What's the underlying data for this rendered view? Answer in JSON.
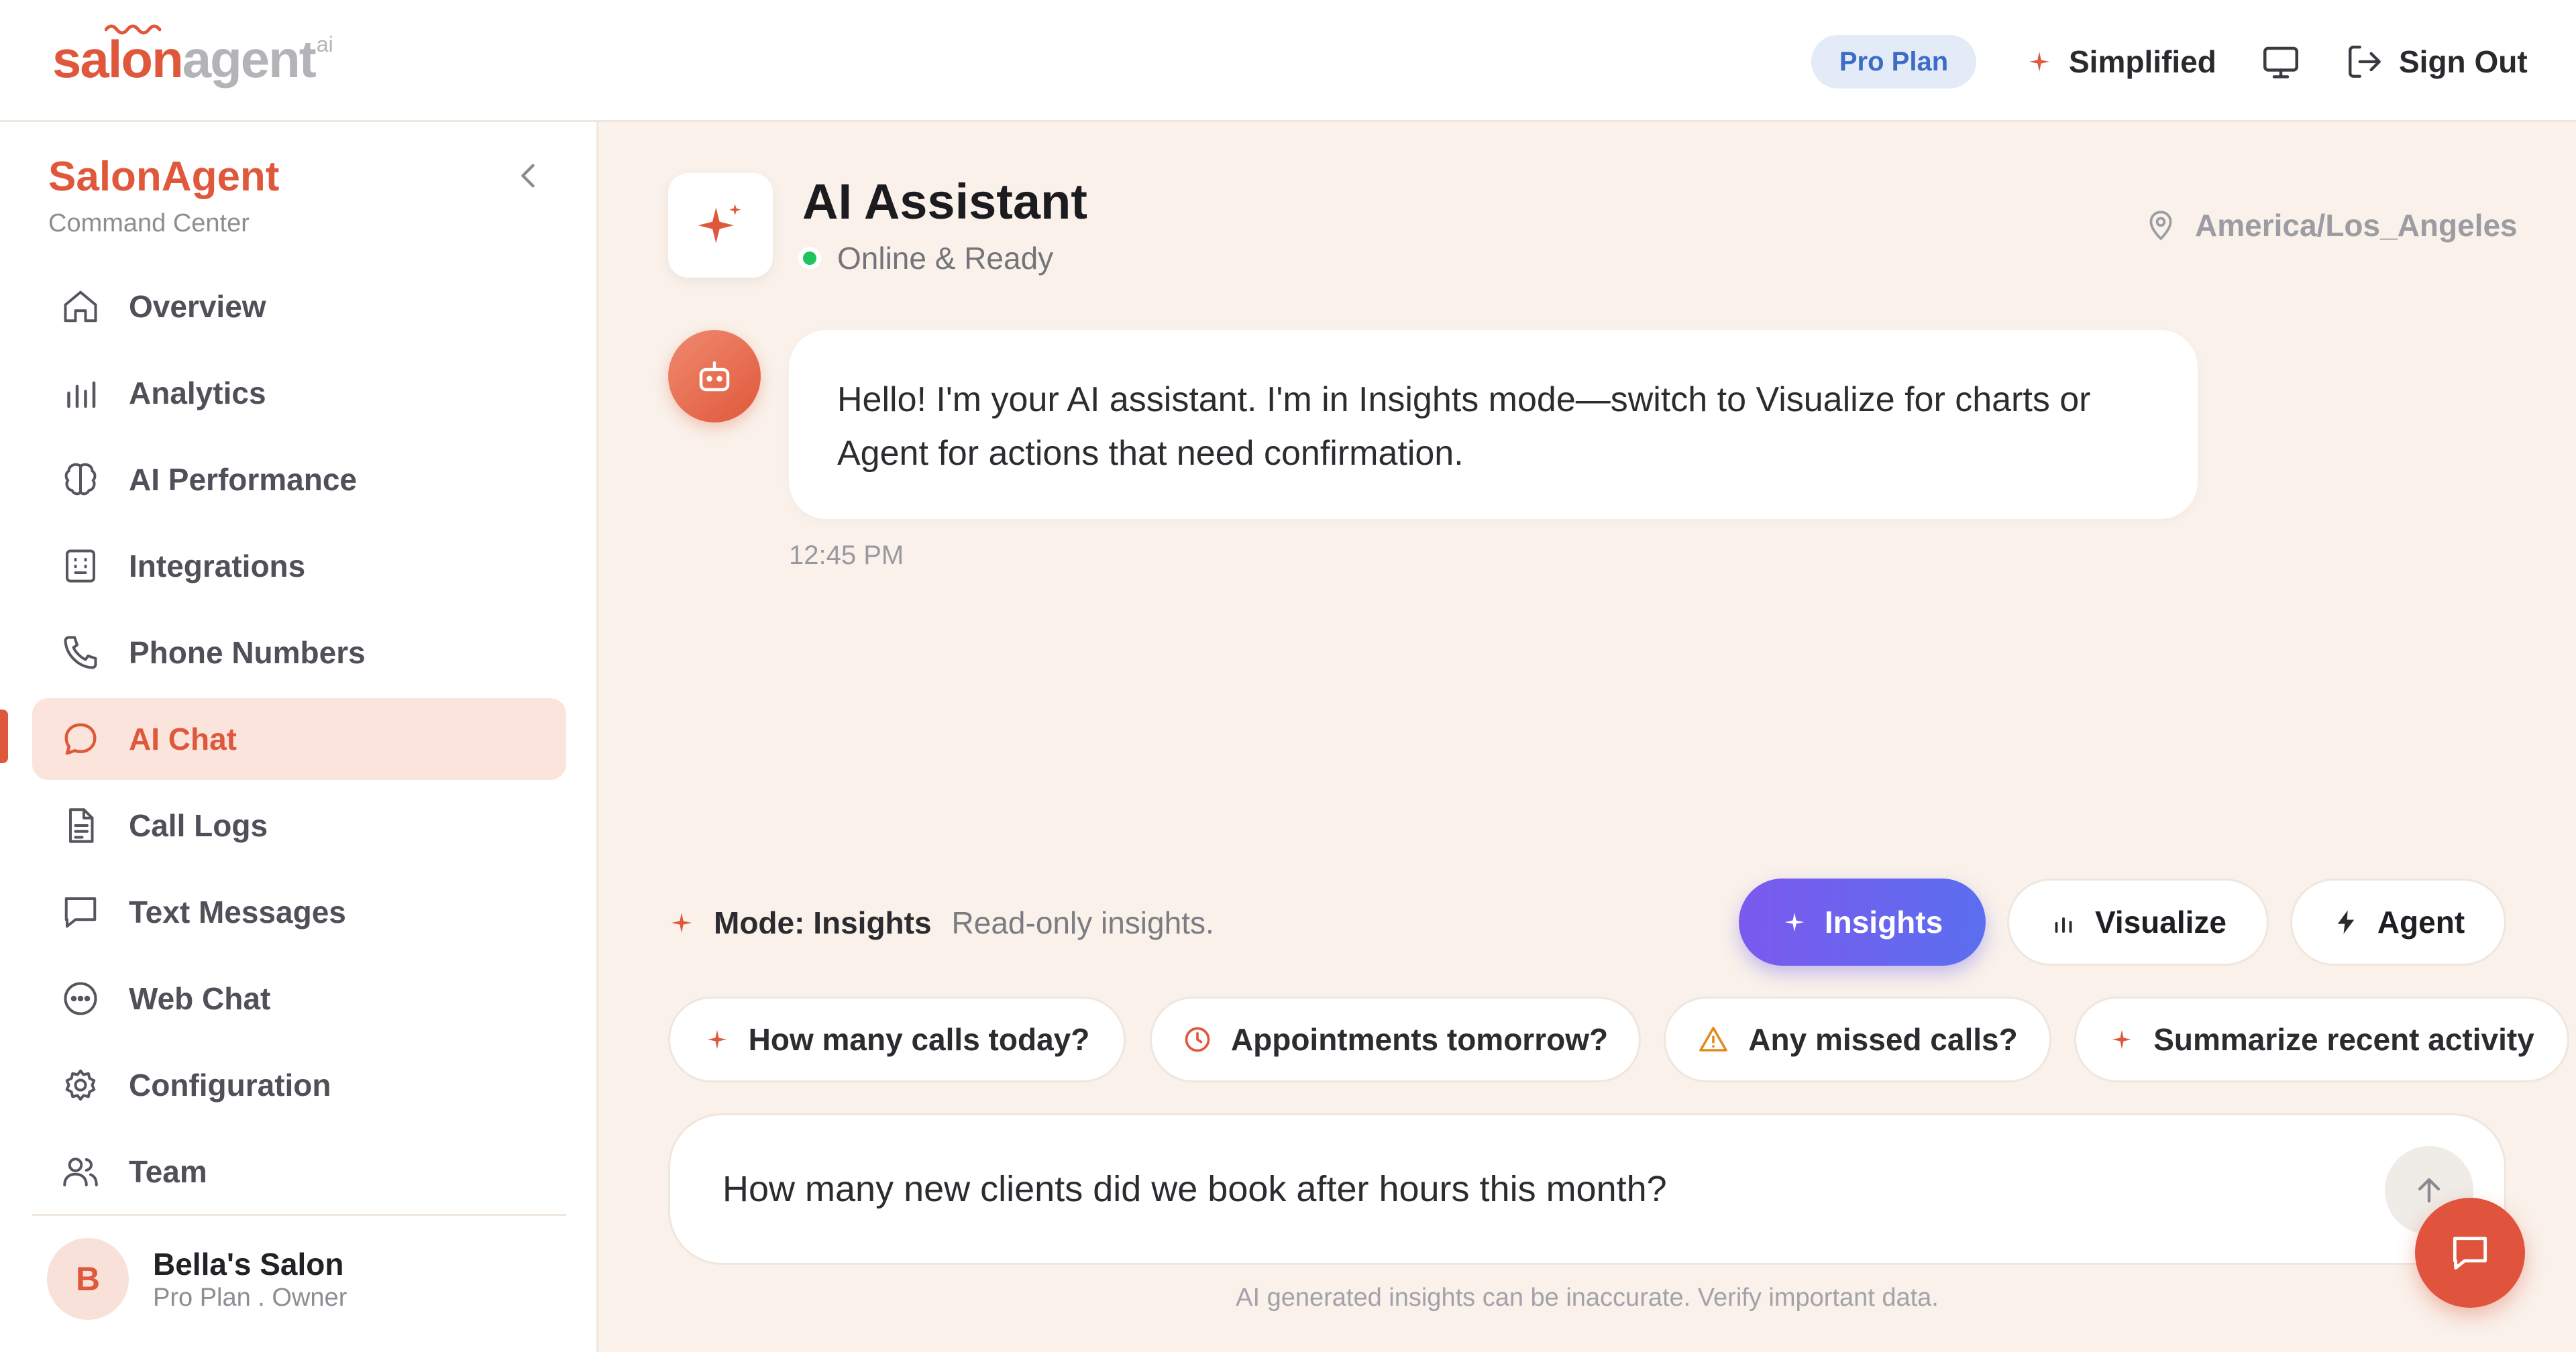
{
  "header": {
    "logo": {
      "part1": "salon",
      "part2": "agent",
      "suffix": "ai"
    },
    "plan_badge": "Pro Plan",
    "simplified_label": "Simplified",
    "sign_out_label": "Sign Out"
  },
  "sidebar": {
    "title": "SalonAgent",
    "subtitle": "Command Center",
    "items": [
      {
        "label": "Overview",
        "icon": "home-icon"
      },
      {
        "label": "Analytics",
        "icon": "bar-chart-icon"
      },
      {
        "label": "AI Performance",
        "icon": "brain-icon"
      },
      {
        "label": "Integrations",
        "icon": "plug-icon"
      },
      {
        "label": "Phone Numbers",
        "icon": "phone-icon"
      },
      {
        "label": "AI Chat",
        "icon": "chat-bubble-icon",
        "active": true
      },
      {
        "label": "Call Logs",
        "icon": "document-icon"
      },
      {
        "label": "Text Messages",
        "icon": "message-square-icon"
      },
      {
        "label": "Web Chat",
        "icon": "web-chat-icon"
      },
      {
        "label": "Configuration",
        "icon": "gear-icon"
      },
      {
        "label": "Team",
        "icon": "users-icon"
      }
    ],
    "account": {
      "initial": "B",
      "name": "Bella's Salon",
      "role": "Pro Plan . Owner"
    }
  },
  "assistant": {
    "title": "AI Assistant",
    "status": "Online & Ready",
    "timezone": "America/Los_Angeles"
  },
  "chat": {
    "message": "Hello! I'm your AI assistant. I'm in Insights mode—switch to Visualize for charts or Agent for actions that need confirmation.",
    "time": "12:45 PM"
  },
  "mode": {
    "label": "Mode: Insights",
    "description": "Read-only insights.",
    "options": [
      {
        "label": "Insights",
        "active": true
      },
      {
        "label": "Visualize",
        "active": false
      },
      {
        "label": "Agent",
        "active": false
      }
    ]
  },
  "suggestions": [
    {
      "label": "How many calls today?",
      "icon": "sparkle-icon"
    },
    {
      "label": "Appointments tomorrow?",
      "icon": "clock-icon"
    },
    {
      "label": "Any missed calls?",
      "icon": "warning-icon"
    },
    {
      "label": "Summarize recent activity",
      "icon": "sparkle-icon"
    }
  ],
  "input": {
    "value": "How many new clients did we book after hours this month?"
  },
  "disclaimer": "AI generated insights can be inaccurate. Verify important data.",
  "colors": {
    "accent": "#e0583c",
    "background": "#f9f1ea",
    "insights_gradient_start": "#7b59ee",
    "insights_gradient_end": "#5b6ff0",
    "online": "#22c35e"
  }
}
